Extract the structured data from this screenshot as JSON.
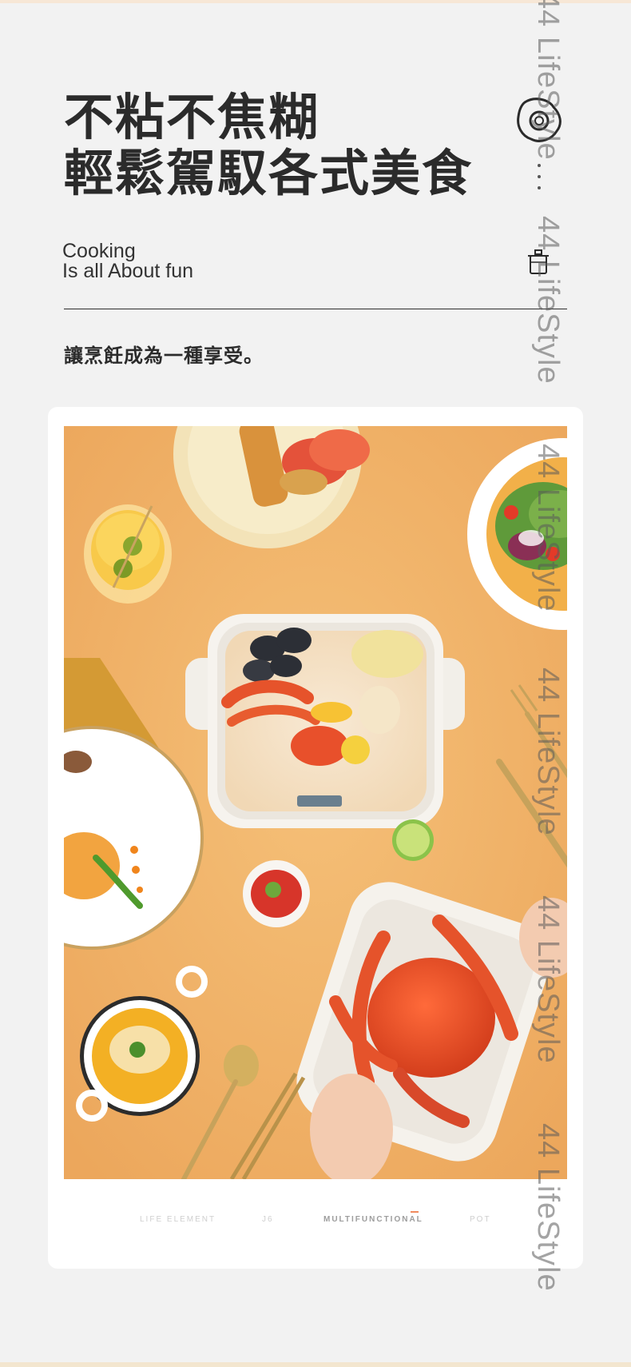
{
  "heading": {
    "line1": "不粘不焦糊",
    "line2": "輕鬆駕馭各式美食"
  },
  "subtitle_en": {
    "line1": "Cooking",
    "line2": "Is all About fun"
  },
  "tagline": "讓烹飪成為一種享受。",
  "watermark": "44 LifeStyle",
  "icons": {
    "egg": "fried-egg-icon",
    "pot": "pot-icon"
  },
  "photo": {
    "description_icon": "food-spread-photo"
  },
  "footer": {
    "item1": "LIFE ELEMENT",
    "item2": "J6",
    "item3": "MULTIFUNCTIONAL",
    "item4": "POT"
  },
  "colors": {
    "background": "#f2f2f2",
    "photo_bg": "#f0b46a",
    "accent": "#f08a5d"
  }
}
